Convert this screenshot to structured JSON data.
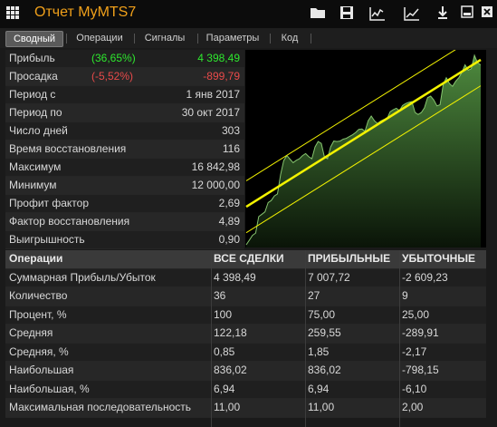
{
  "window": {
    "title": "Отчет MyMTS7"
  },
  "toolbar": {
    "icons": [
      "folder-icon",
      "save-icon",
      "chart-settings-icon",
      "equity-chart-icon",
      "download-icon",
      "minimize-icon",
      "close-icon"
    ]
  },
  "tabs": [
    {
      "label": "Сводный",
      "active": true
    },
    {
      "label": "Операции",
      "active": false
    },
    {
      "label": "Сигналы",
      "active": false
    },
    {
      "label": "Параметры",
      "active": false
    },
    {
      "label": "Код",
      "active": false
    }
  ],
  "summary": [
    {
      "label": "Прибыль",
      "pct": "(36,65%)",
      "value": "4 398,49",
      "tone": "pos"
    },
    {
      "label": "Просадка",
      "pct": "(-5,52%)",
      "value": "-899,79",
      "tone": "neg"
    },
    {
      "label": "Период с",
      "pct": "",
      "value": "1 янв 2017",
      "tone": ""
    },
    {
      "label": "Период по",
      "pct": "",
      "value": "30 окт 2017",
      "tone": ""
    },
    {
      "label": "Число дней",
      "pct": "",
      "value": "303",
      "tone": ""
    },
    {
      "label": "Время восстановления",
      "pct": "",
      "value": "116",
      "tone": ""
    },
    {
      "label": "Максимум",
      "pct": "",
      "value": "16 842,98",
      "tone": ""
    },
    {
      "label": "Минимум",
      "pct": "",
      "value": "12 000,00",
      "tone": ""
    },
    {
      "label": "Профит фактор",
      "pct": "",
      "value": "2,69",
      "tone": ""
    },
    {
      "label": "Фактор восстановления",
      "pct": "",
      "value": "4,89",
      "tone": ""
    },
    {
      "label": "Выигрышность",
      "pct": "",
      "value": "0,90",
      "tone": ""
    }
  ],
  "colors": {
    "accent": "#f0a01a",
    "positive": "#2ee82e",
    "negative": "#e84a4a",
    "equity_fill": "#2f5a24",
    "trend_line": "#f2f200"
  },
  "equity_chart": {
    "type": "area",
    "ylim": [
      12000,
      16842.98
    ],
    "values": [
      12000,
      12120,
      12240,
      12300,
      12720,
      12780,
      12840,
      13080,
      13130,
      13250,
      13300,
      13800,
      14150,
      14280,
      14190,
      14100,
      14160,
      14200,
      14280,
      14330,
      14250,
      14200,
      14500,
      14640,
      14590,
      14250,
      14200,
      14500,
      14650,
      14640,
      14650,
      14700,
      14720,
      14770,
      14810,
      14870,
      14950,
      14960,
      14900,
      15170,
      15290,
      15170,
      15100,
      15160,
      15200,
      15210,
      15400,
      15450,
      15490,
      15430,
      15560,
      15610,
      15640,
      15660,
      15380,
      15330,
      15380,
      15500,
      15760,
      15800,
      15700,
      15550,
      15580,
      16100,
      16270,
      16120,
      16050,
      16180,
      16270,
      16410,
      16600,
      16460,
      16500,
      16843,
      16650,
      16600
    ]
  },
  "table": {
    "headers": [
      "Операции",
      "ВСЕ СДЕЛКИ",
      "ПРИБЫЛЬНЫЕ",
      "УБЫТОЧНЫЕ"
    ],
    "rows": [
      [
        "Суммарная Прибыль/Убыток",
        "4 398,49",
        "7 007,72",
        "-2 609,23"
      ],
      [
        "Количество",
        "36",
        "27",
        "9"
      ],
      [
        "Процент, %",
        "100",
        "75,00",
        "25,00"
      ],
      [
        "Средняя",
        "122,18",
        "259,55",
        "-289,91"
      ],
      [
        "Средняя, %",
        "0,85",
        "1,85",
        "-2,17"
      ],
      [
        "Наибольшая",
        "836,02",
        "836,02",
        "-798,15"
      ],
      [
        "Наибольшая, %",
        "6,94",
        "6,94",
        "-6,10"
      ],
      [
        "Максимальная последовательность",
        "11,00",
        "11,00",
        "2,00"
      ]
    ]
  }
}
